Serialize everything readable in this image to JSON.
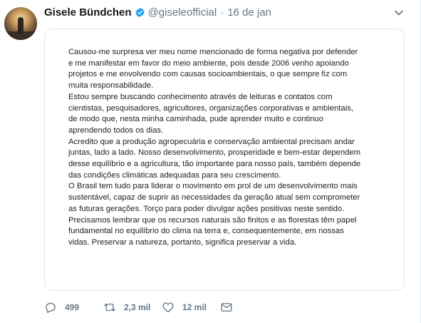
{
  "author": {
    "name": "Gisele Bündchen",
    "handle": "@giseleofficial",
    "separator": "·",
    "date": "16 de jan",
    "verified": true
  },
  "icons": {
    "verified": "verified-badge-icon",
    "caret": "chevron-down-icon",
    "reply": "reply-icon",
    "retweet": "retweet-icon",
    "like": "heart-icon",
    "dm": "envelope-icon"
  },
  "colors": {
    "verified_blue": "#1da1f2",
    "muted": "#657786"
  },
  "statement": {
    "lines": [
      "Causou-me surpresa ver meu nome mencionado de forma negativa por defender",
      "e me manifestar em favor do meio ambiente, pois desde 2006 venho apoiando",
      "projetos e me envolvendo com causas socioambientais, o que sempre fiz com",
      "muita responsabilidade.",
      "Estou sempre buscando conhecimento através de leituras e contatos com",
      "cientistas, pesquisadores, agricultores, organizações corporativas e ambientais,",
      "de modo que, nesta minha caminhada, pude aprender muito e continuo",
      "aprendendo todos os dias.",
      "Acredito que a produção agropecuária e conservação ambiental precisam andar",
      "juntas, lado a lado. Nosso desenvolvimento, prosperidade e bem-estar dependem",
      "desse equilíbrio e a agricultura, tão importante para nosso país, também depende",
      "das condições climáticas adequadas para seu crescimento.",
      "O Brasil tem tudo para liderar o movimento em prol de um desenvolvimento mais",
      "sustentável, capaz de suprir as necessidades da geração atual sem comprometer",
      "as futuras gerações. Torço para poder divulgar ações positivas neste sentido.",
      "Precisamos lembrar que os recursos naturais são finitos e as florestas têm papel",
      "fundamental no equilíbrio do clima na terra e, consequentemente, em nossas",
      "vidas. Preservar a natureza, portanto, significa preservar a vida."
    ]
  },
  "actions": {
    "replies": "499",
    "retweets": "2,3 mil",
    "likes": "12 mil"
  }
}
